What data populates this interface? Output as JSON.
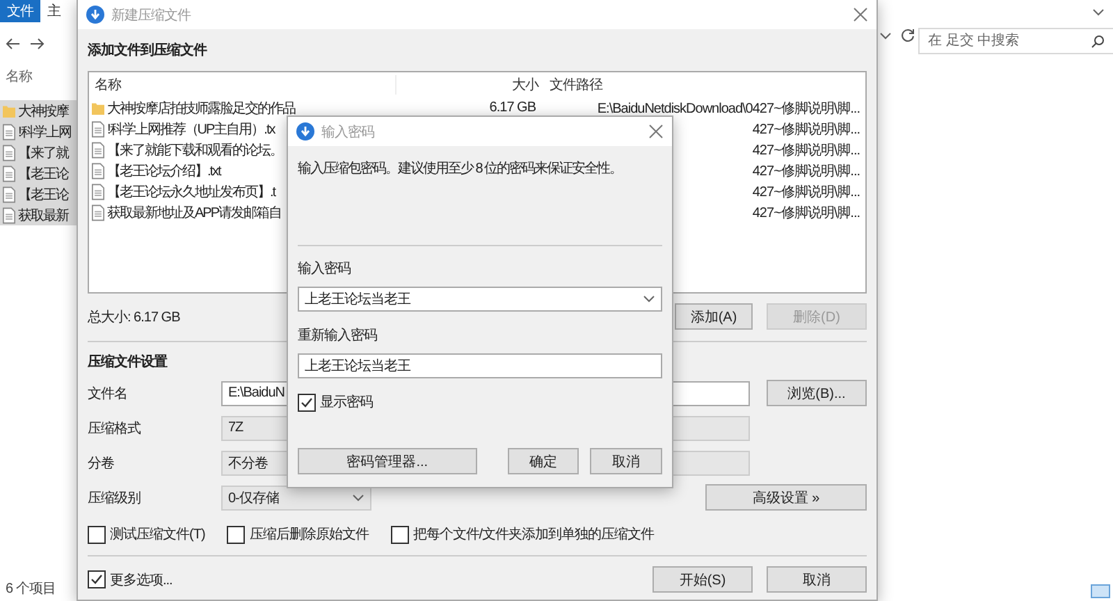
{
  "explorer": {
    "ribbon_tabs": [
      {
        "label": "文件",
        "selected": true
      },
      {
        "label": "主",
        "selected": false
      }
    ],
    "column_header": "名称",
    "items": [
      {
        "name": "大神按摩",
        "kind": "folder",
        "selected": true
      },
      {
        "name": "!科学上网",
        "kind": "file",
        "selected": true
      },
      {
        "name": "【来了就",
        "kind": "file",
        "selected": true
      },
      {
        "name": "【老王论",
        "kind": "file",
        "selected": true
      },
      {
        "name": "【老王论",
        "kind": "file",
        "selected": true
      },
      {
        "name": "获取最新",
        "kind": "file",
        "selected": true
      }
    ],
    "status": "6 个项目",
    "search": {
      "placeholder": "在 足交 中搜索"
    }
  },
  "compress_dialog": {
    "title": "新建压缩文件",
    "section_title": "添加文件到压缩文件",
    "columns": [
      "名称",
      "大小",
      "文件路径"
    ],
    "files": [
      {
        "name": "大神按摩店拍技师露脸足交的作品",
        "kind": "folder",
        "size": "6.17 GB",
        "path": "E:\\BaiduNetdiskDownload\\0427~修脚说明\\脚..."
      },
      {
        "name": "!科学上网推荐（UP主自用）.tx",
        "kind": "file",
        "path": "427~修脚说明\\脚..."
      },
      {
        "name": "【来了就能下载和观看的论坛。",
        "kind": "file",
        "path": "427~修脚说明\\脚..."
      },
      {
        "name": "【老王论坛介绍】.txt",
        "kind": "file",
        "path": "427~修脚说明\\脚..."
      },
      {
        "name": "【老王论坛永久地址发布页】.t",
        "kind": "file",
        "path": "427~修脚说明\\脚..."
      },
      {
        "name": "获取最新地址及APP请发邮箱自",
        "kind": "file",
        "path": "427~修脚说明\\脚..."
      }
    ],
    "total_size": "总大小: 6.17 GB",
    "add_button": {
      "label": "添加(A)",
      "disabled": false
    },
    "remove_button": {
      "label": "删除(D)",
      "disabled": true
    },
    "settings_title": "压缩文件设置",
    "fields": [
      {
        "label": "文件名",
        "kind": "text",
        "value": "E:\\BaiduN",
        "button": "浏览(B)..."
      },
      {
        "label": "压缩格式",
        "kind": "static",
        "value": "7Z"
      },
      {
        "label": "分卷",
        "kind": "static",
        "value": "不分卷"
      },
      {
        "label": "压缩级别",
        "kind": "select",
        "value": "0-仅存储",
        "button": "高级设置 »"
      }
    ],
    "options": [
      {
        "label": "测试压缩文件(T)",
        "checked": false
      },
      {
        "label": "压缩后删除原始文件",
        "checked": false
      },
      {
        "label": "把每个文件/文件夹添加到单独的压缩文件",
        "checked": false
      }
    ],
    "more_options": {
      "label": "更多选项...",
      "checked": true
    },
    "buttons": [
      "开始(S)",
      "取消"
    ]
  },
  "password_dialog": {
    "title": "输入密码",
    "message": "输入压缩包密码。建议使用至少 8 位的密码来保证安全性。",
    "password_label": "输入密码",
    "password_value": "上老王论坛当老王",
    "confirm_label": "重新输入密码",
    "confirm_value": "上老王论坛当老王",
    "show_password": {
      "label": "显示密码",
      "checked": true
    },
    "buttons": [
      "密码管理器...",
      "确定",
      "取消"
    ]
  }
}
